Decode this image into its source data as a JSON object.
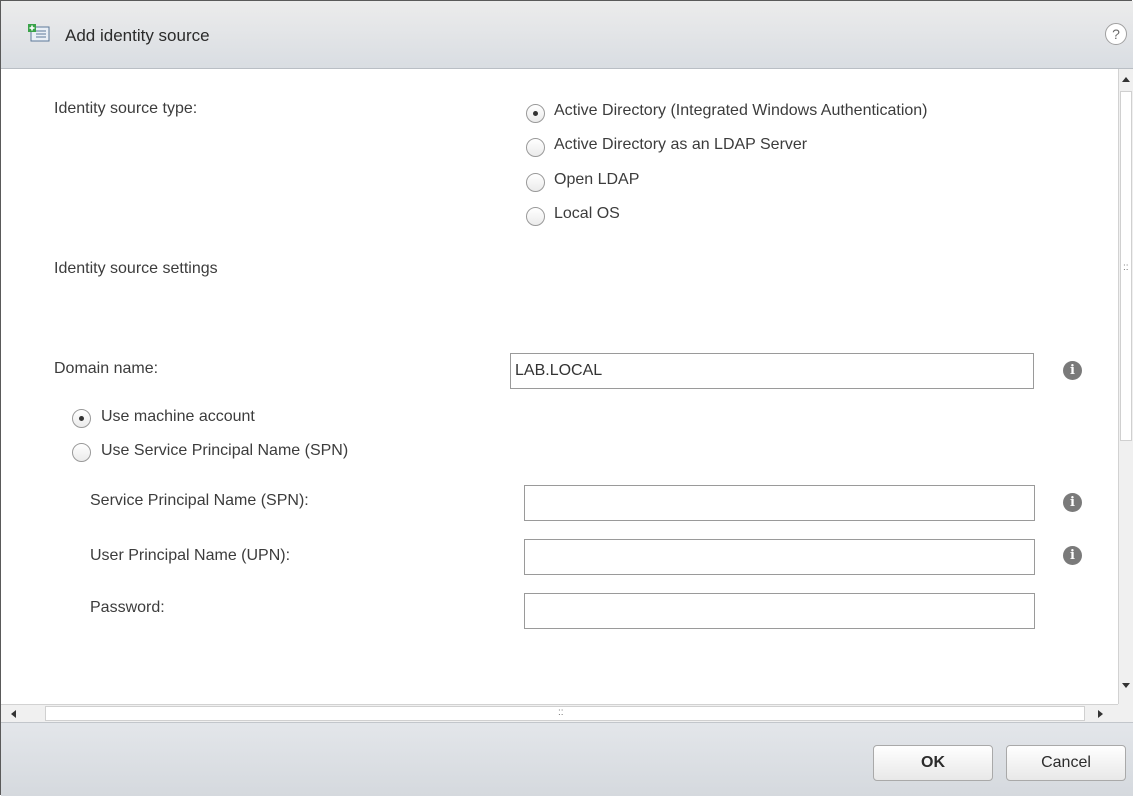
{
  "dialog": {
    "title": "Add identity source",
    "help_icon": "?"
  },
  "form": {
    "identity_source_type_label": "Identity source type:",
    "source_types": [
      {
        "label": "Active Directory (Integrated Windows Authentication)",
        "selected": true
      },
      {
        "label": "Active Directory as an LDAP Server",
        "selected": false
      },
      {
        "label": "Open LDAP",
        "selected": false
      },
      {
        "label": "Local OS",
        "selected": false
      }
    ],
    "identity_source_settings_label": "Identity source settings",
    "domain_name_label": "Domain name:",
    "domain_name_value": "LAB.LOCAL",
    "account_options": [
      {
        "label": "Use machine account",
        "selected": true
      },
      {
        "label": "Use Service Principal Name (SPN)",
        "selected": false
      }
    ],
    "spn_label": "Service Principal Name (SPN):",
    "spn_value": "",
    "upn_label": "User Principal Name (UPN):",
    "upn_value": "",
    "password_label": "Password:",
    "password_value": "",
    "info_icon_glyph": "i"
  },
  "scrollbar": {
    "grip_glyph": "::"
  },
  "footer": {
    "ok_label": "OK",
    "cancel_label": "Cancel"
  }
}
